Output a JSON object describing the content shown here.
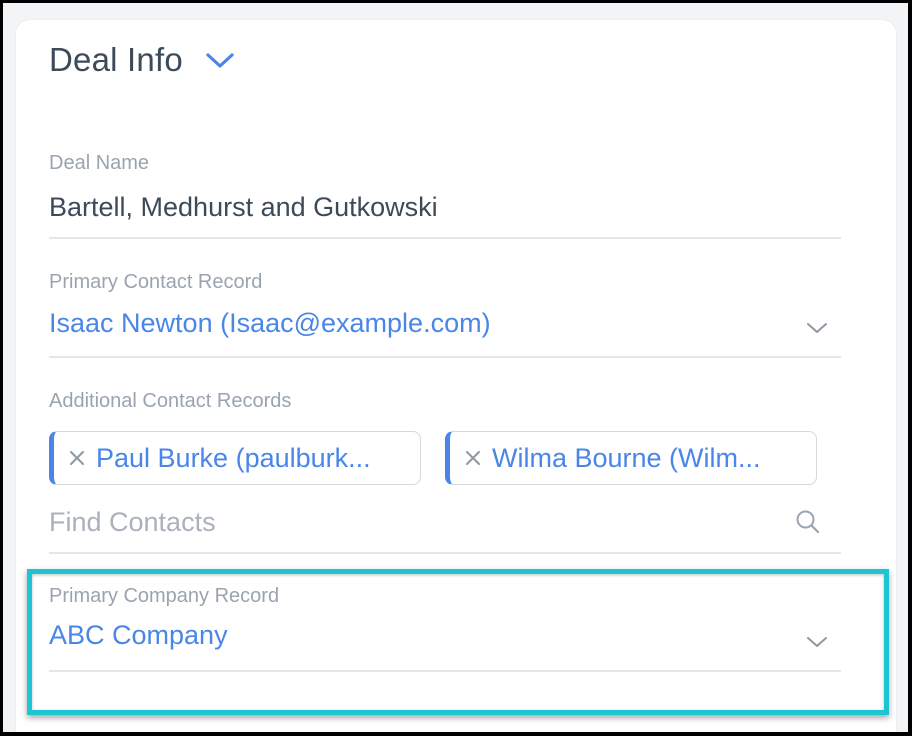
{
  "panel": {
    "title": "Deal Info"
  },
  "deal_name": {
    "label": "Deal Name",
    "value": "Bartell, Medhurst and Gutkowski"
  },
  "primary_contact": {
    "label": "Primary Contact Record",
    "value": "Isaac Newton (Isaac@example.com)"
  },
  "additional_contacts": {
    "label": "Additional Contact Records",
    "tags": [
      {
        "label": "Paul Burke (paulburk..."
      },
      {
        "label": "Wilma Bourne (Wilm..."
      }
    ],
    "search_placeholder": "Find Contacts"
  },
  "primary_company": {
    "label": "Primary Company Record",
    "value": "ABC Company"
  },
  "colors": {
    "accent": "#4a86e8",
    "highlight": "#1bc5d1",
    "heading": "#3d4a59",
    "label": "#9aa4b0"
  },
  "icons": {
    "header_toggle": "chevron-down-icon",
    "select_toggle": "chevron-down-icon",
    "tag_remove": "close-icon",
    "search": "search-icon"
  }
}
